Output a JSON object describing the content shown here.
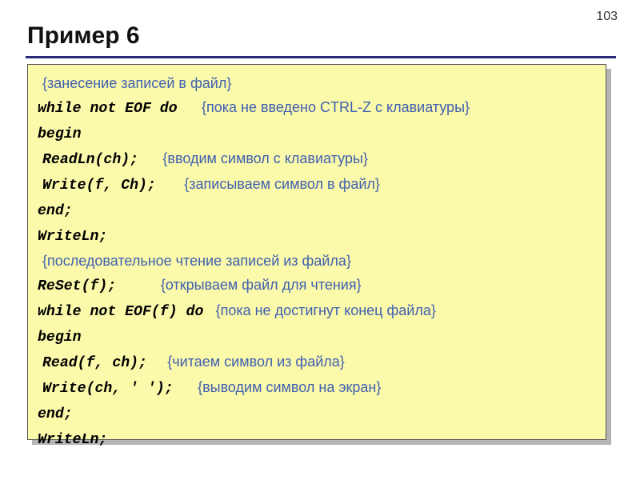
{
  "page_number": "103",
  "title": "Пример 6",
  "lines": {
    "l0": {
      "comment": "{занесение записей в файл}"
    },
    "l1": {
      "code": "while not EOF do",
      "comment": "{пока не введено CTRL-Z с клавиатуры}"
    },
    "l2": {
      "code": "begin"
    },
    "l3": {
      "code": "ReadLn(ch);",
      "comment": "{вводим символ с клавиатуры}"
    },
    "l4": {
      "code": "Write(f, Ch);",
      "comment": "{записываем символ в файл}"
    },
    "l5": {
      "code": "end;"
    },
    "l6": {
      "code": "WriteLn;"
    },
    "l7": {
      "comment": "{последовательное чтение записей из файла}"
    },
    "l8": {
      "code": "ReSet(f);",
      "comment": "{открываем файл для чтения}"
    },
    "l9": {
      "code": "while not EOF(f) do",
      "comment": "{пока не достигнут конец файла}"
    },
    "l10": {
      "code": "begin"
    },
    "l11": {
      "code": "Read(f, ch);",
      "comment": "{читаем символ из файла}"
    },
    "l12": {
      "code": "Write(ch, ' ');",
      "comment": "{выводим символ на экран}"
    },
    "l13": {
      "code": "end;"
    },
    "l14": {
      "code": "WriteLn;"
    }
  }
}
